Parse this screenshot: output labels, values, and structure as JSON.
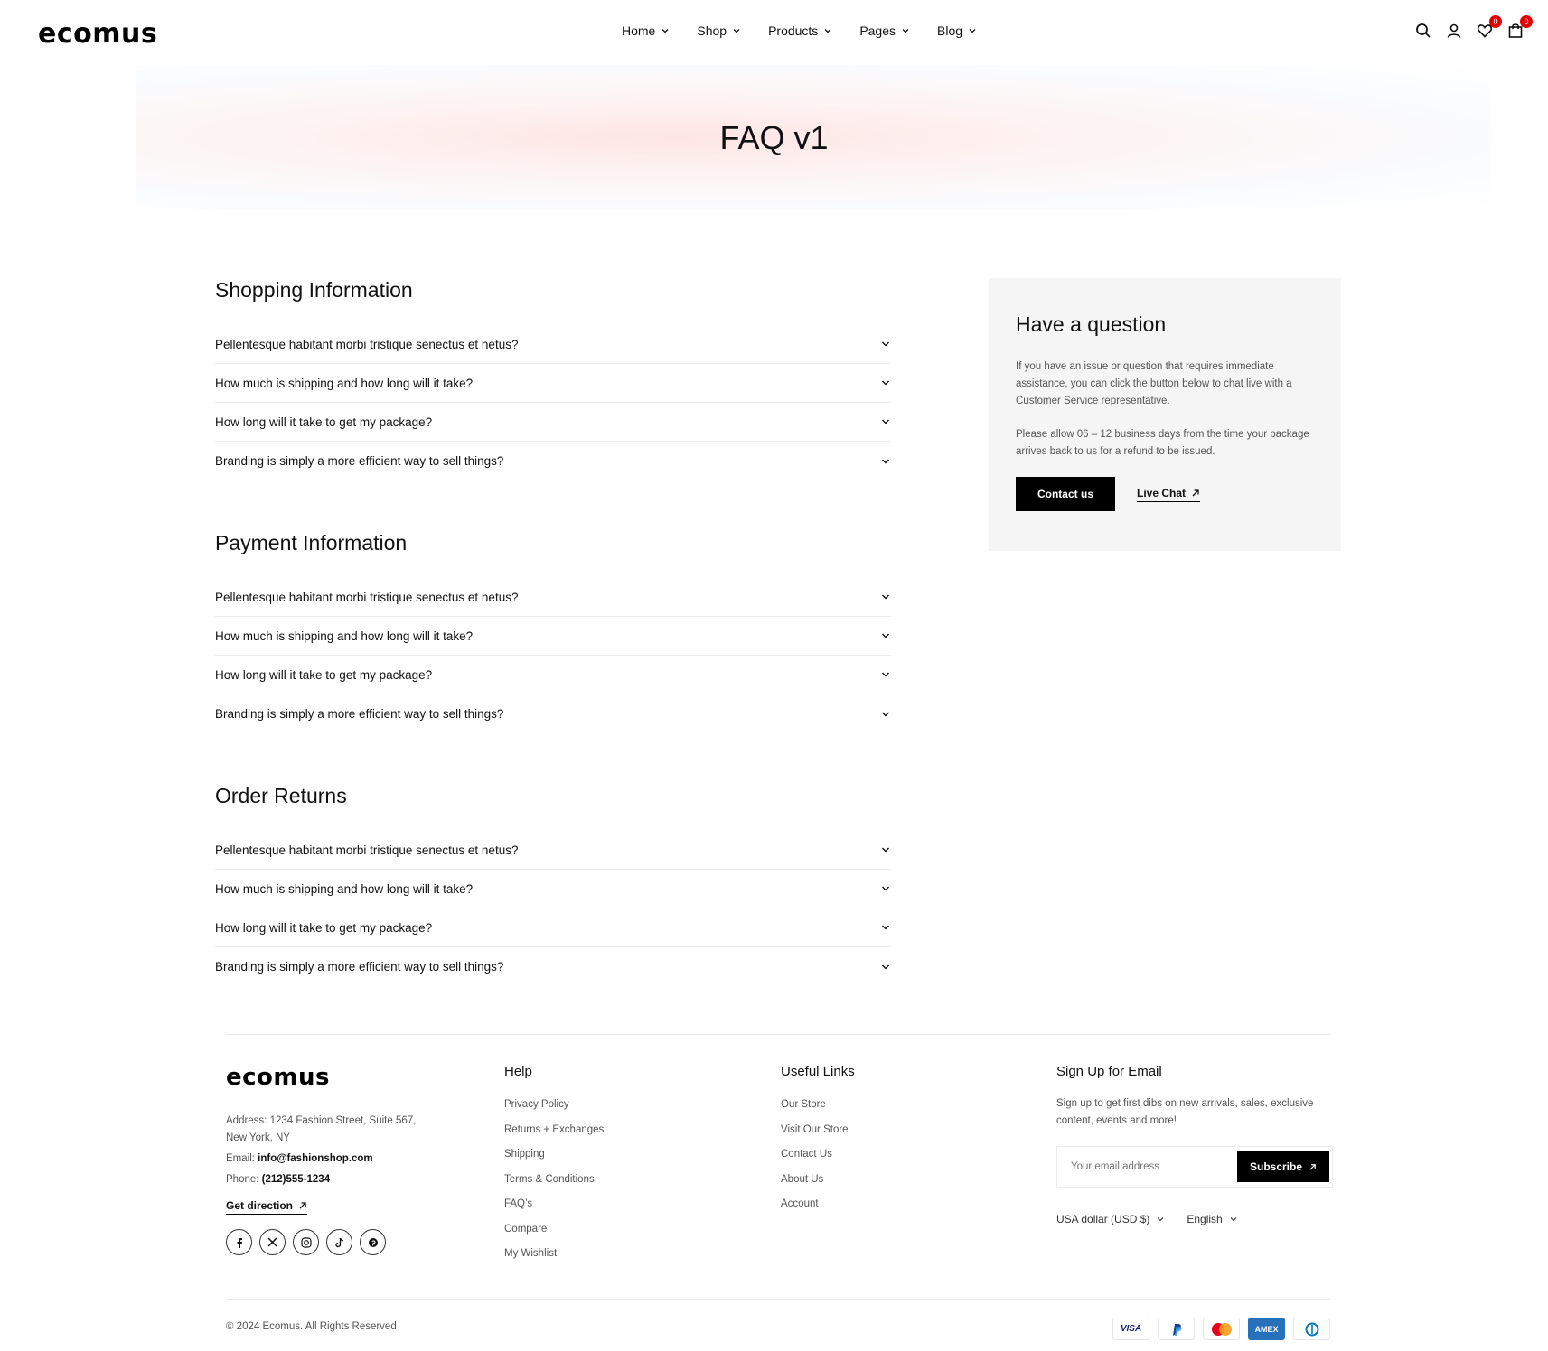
{
  "header": {
    "logo": "ecomus",
    "nav": [
      "Home",
      "Shop",
      "Products",
      "Pages",
      "Blog"
    ],
    "wishlist_count": "0",
    "cart_count": "0"
  },
  "hero": {
    "title": "FAQ v1"
  },
  "faq": {
    "sections": [
      {
        "title": "Shopping Information",
        "items": [
          "Pellentesque habitant morbi tristique senectus et netus?",
          "How much is shipping and how long will it take?",
          "How long will it take to get my package?",
          "Branding is simply a more efficient way to sell things?"
        ]
      },
      {
        "title": "Payment Information",
        "items": [
          "Pellentesque habitant morbi tristique senectus et netus?",
          "How much is shipping and how long will it take?",
          "How long will it take to get my package?",
          "Branding is simply a more efficient way to sell things?"
        ]
      },
      {
        "title": "Order Returns",
        "items": [
          "Pellentesque habitant morbi tristique senectus et netus?",
          "How much is shipping and how long will it take?",
          "How long will it take to get my package?",
          "Branding is simply a more efficient way to sell things?"
        ]
      }
    ]
  },
  "question_box": {
    "title": "Have a question",
    "p1": "If you have an issue or question that requires immediate assistance, you can click the button below to chat live with a Customer Service representative.",
    "p2": "Please allow 06 – 12 business days from the time your package arrives back to us for a refund to be issued.",
    "contact_label": "Contact us",
    "chat_label": "Live Chat"
  },
  "footer": {
    "logo": "ecomus",
    "address_label": "Address:",
    "address": "1234 Fashion Street, Suite 567,",
    "address2": "New York, NY",
    "email_label": "Email:",
    "email": "info@fashionshop.com",
    "phone_label": "Phone:",
    "phone": "(212)555-1234",
    "direction": "Get direction",
    "help_title": "Help",
    "help_links": [
      "Privacy Policy",
      "Returns + Exchanges",
      "Shipping",
      "Terms & Conditions",
      "FAQ’s",
      "Compare",
      "My Wishlist"
    ],
    "useful_title": "Useful Links",
    "useful_links": [
      "Our Store",
      "Visit Our Store",
      "Contact Us",
      "About Us",
      "Account"
    ],
    "signup_title": "Sign Up for Email",
    "signup_text": "Sign up to get first dibs on new arrivals, sales, exclusive content, events and more!",
    "email_placeholder": "Your email address",
    "subscribe": "Subscribe",
    "currency": "USA dollar (USD $)",
    "language": "English",
    "copyright": "© 2024 Ecomus. All Rights Reserved",
    "payments": [
      "VISA",
      "PayPal",
      "Mastercard",
      "AMEX",
      "Diners"
    ]
  }
}
